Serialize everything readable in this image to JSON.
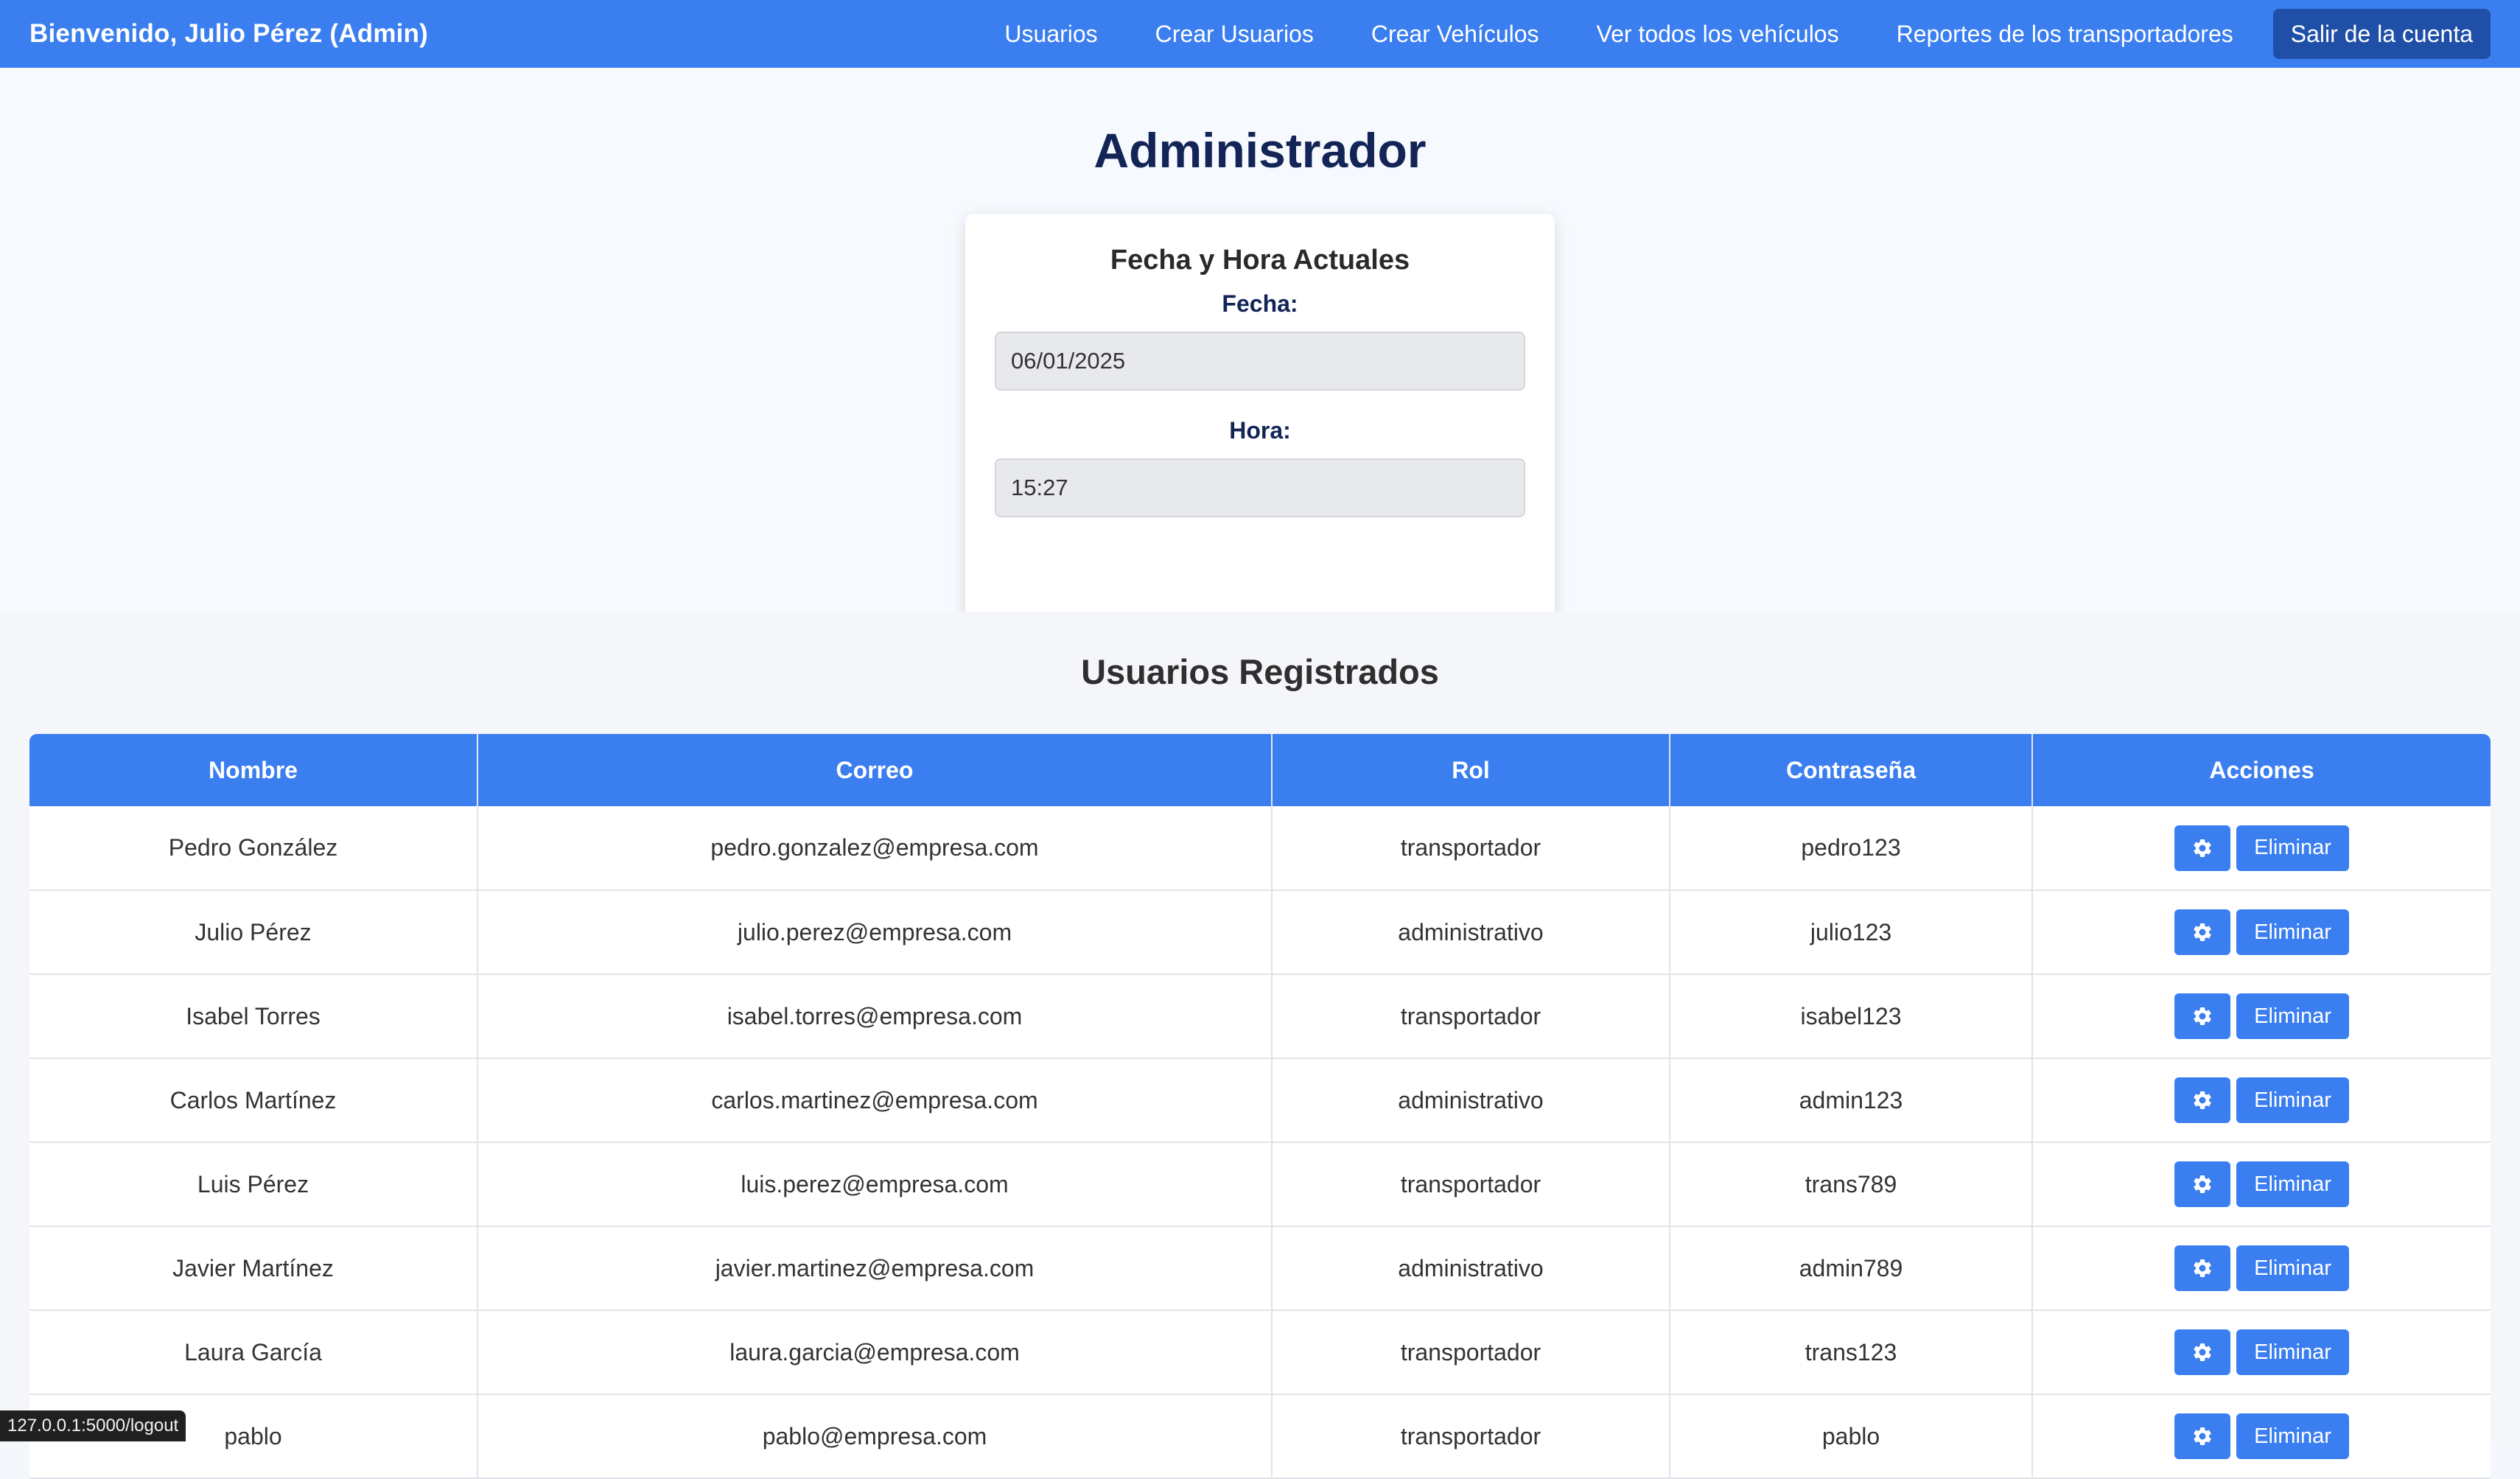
{
  "navbar": {
    "brand": "Bienvenido, Julio Pérez (Admin)",
    "links": [
      {
        "label": "Usuarios"
      },
      {
        "label": "Crear Usuarios"
      },
      {
        "label": "Crear Vehículos"
      },
      {
        "label": "Ver todos los vehículos"
      },
      {
        "label": "Reportes de los transportadores"
      }
    ],
    "logout_label": "Salir de la cuenta"
  },
  "hero": {
    "title": "Administrador",
    "datetime_card": {
      "title": "Fecha y Hora Actuales",
      "date_label": "Fecha:",
      "date_value": "06/01/2025",
      "time_label": "Hora:",
      "time_value": "15:27"
    }
  },
  "users": {
    "title": "Usuarios Registrados",
    "columns": [
      "Nombre",
      "Correo",
      "Rol",
      "Contraseña",
      "Acciones"
    ],
    "delete_label": "Eliminar",
    "rows": [
      {
        "name": "Pedro González",
        "email": "pedro.gonzalez@empresa.com",
        "role": "transportador",
        "password": "pedro123"
      },
      {
        "name": "Julio Pérez",
        "email": "julio.perez@empresa.com",
        "role": "administrativo",
        "password": "julio123"
      },
      {
        "name": "Isabel Torres",
        "email": "isabel.torres@empresa.com",
        "role": "transportador",
        "password": "isabel123"
      },
      {
        "name": "Carlos Martínez",
        "email": "carlos.martinez@empresa.com",
        "role": "administrativo",
        "password": "admin123"
      },
      {
        "name": "Luis Pérez",
        "email": "luis.perez@empresa.com",
        "role": "transportador",
        "password": "trans789"
      },
      {
        "name": "Javier Martínez",
        "email": "javier.martinez@empresa.com",
        "role": "administrativo",
        "password": "admin789"
      },
      {
        "name": "Laura García",
        "email": "laura.garcia@empresa.com",
        "role": "transportador",
        "password": "trans123"
      },
      {
        "name": "pablo",
        "email": "pablo@empresa.com",
        "role": "transportador",
        "password": "pablo"
      }
    ]
  },
  "status_bar": {
    "url": "127.0.0.1:5000/logout"
  },
  "colors": {
    "primary": "#3a7ef0",
    "logout_bg": "#1f4fa6",
    "title": "#132456"
  },
  "icons": {
    "edit_action": "gear-icon"
  }
}
